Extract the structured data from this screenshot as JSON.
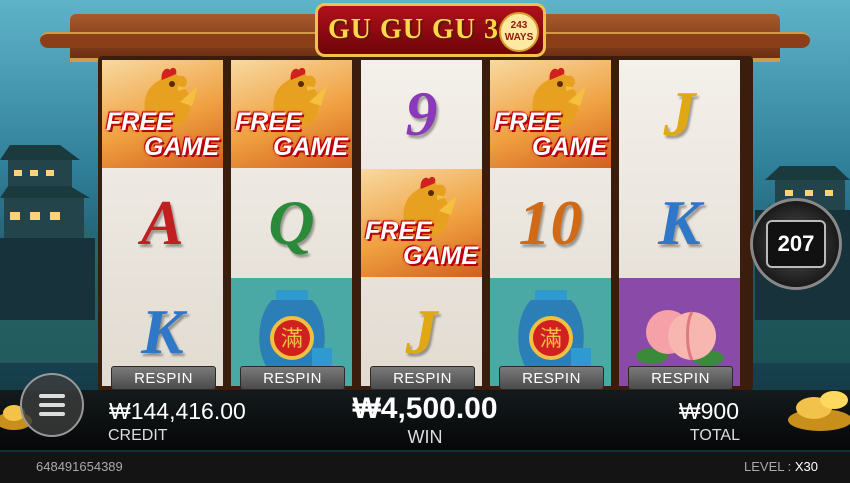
{
  "game": {
    "title": "GU GU GU 3",
    "ways_number": "243",
    "ways_label": "WAYS"
  },
  "reels": [
    [
      "free_game",
      "A",
      "K"
    ],
    [
      "free_game",
      "Q",
      "wine_vase"
    ],
    [
      "9",
      "free_game",
      "J"
    ],
    [
      "free_game",
      "10",
      "wine_vase"
    ],
    [
      "J",
      "K",
      "peach"
    ]
  ],
  "free_game_label": [
    "FREE",
    "GAME"
  ],
  "respin_label": "RESPIN",
  "spin_counter": "207",
  "credit": {
    "value": "₩144,416.00",
    "label": "CREDIT"
  },
  "win": {
    "value": "₩4,500.00",
    "label": "WIN"
  },
  "total": {
    "value": "₩900",
    "label": "TOTAL"
  },
  "footer": {
    "round_id": "648491654389",
    "level_label": "LEVEL :",
    "level_value": "X30"
  },
  "icons": {
    "rooster": "rooster-icon",
    "vase": "vase-icon",
    "peach": "peach-icon",
    "menu": "menu-icon"
  },
  "colors": {
    "accent_gold": "#ffd84a",
    "logo_red": "#b0111b",
    "free_label_red": "#b00010"
  }
}
